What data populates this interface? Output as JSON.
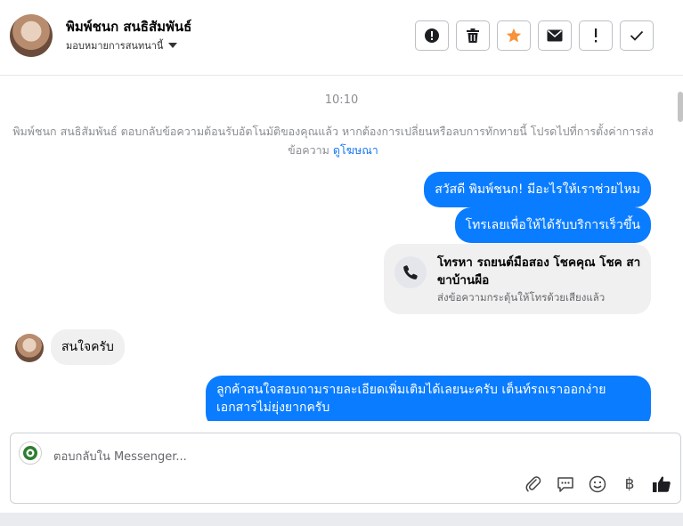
{
  "header": {
    "contact_name": "พิมพ์ชนก สนธิสัมพันธ์",
    "assign_label": "มอบหมายการสนทนานี้"
  },
  "toolbar": {
    "buttons": [
      "alert-circle-icon",
      "trash-icon",
      "star-icon",
      "envelope-icon",
      "exclamation-icon",
      "check-icon"
    ],
    "star_color": "#f7923b"
  },
  "chat": {
    "timestamp": "10:10",
    "system_text": "พิมพ์ชนก สนธิสัมพันธ์ ตอบกลับข้อความต้อนรับอัตโนมัติของคุณแล้ว หากต้องการเปลี่ยนหรือลบการทักทายนี้ โปรดไปที่การตั้งค่าการส่งข้อความ",
    "system_link": "ดูโฆษณา",
    "messages": [
      {
        "dir": "out",
        "text": "สวัสดี พิมพ์ชนก! มีอะไรให้เราช่วยไหม"
      },
      {
        "dir": "out",
        "text": "โทรเลยเพื่อให้ได้รับบริการเร็วขึ้น"
      },
      {
        "dir": "in",
        "text": "สนใจครับ"
      },
      {
        "dir": "out",
        "text": "ลูกค้าสนใจสอบถามรายละเอียดเพิ่มเติมได้เลยนะครับ เต็นท์รถเราออกง่าย เอกสารไม่ยุ่งยากครับ"
      }
    ],
    "call_card": {
      "title": "โทรหา รถยนต์มือสอง โชคคุณ โชค สาขาบ้านผือ",
      "subtitle": "ส่งข้อความกระตุ้นให้โทรด้วยเสียงแล้ว"
    },
    "outgoing_color": "#0a7cff"
  },
  "composer": {
    "placeholder": "ตอบกลับใน Messenger...",
    "tools": [
      "paperclip-icon",
      "saved-reply-icon",
      "emoji-icon",
      "baht-icon",
      "like-icon"
    ],
    "baht_glyph": "฿"
  }
}
